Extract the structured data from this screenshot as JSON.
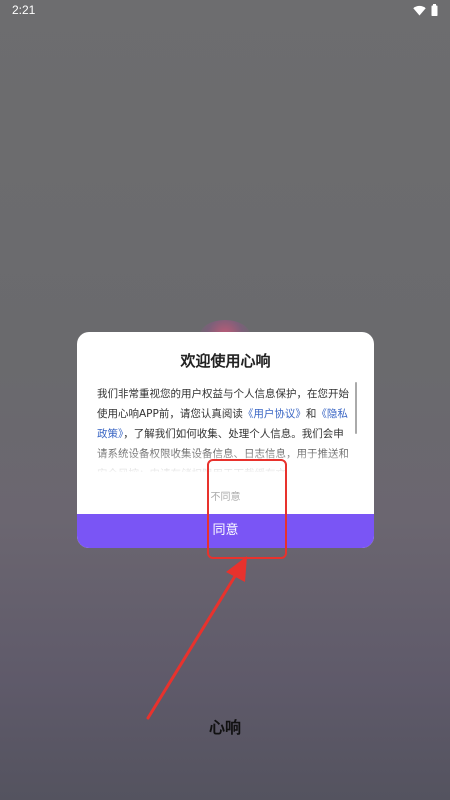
{
  "status_bar": {
    "time": "2:21",
    "wifi_icon": "wifi-icon",
    "battery_icon": "battery-icon"
  },
  "dialog": {
    "title": "欢迎使用心响",
    "body": {
      "p1": "我们非常重视您的用户权益与个人信息保护，在您开始使用心响APP前，请您认真阅读",
      "link_user_agreement": "《用户协议》",
      "and": "和",
      "link_privacy_policy": "《隐私政策》",
      "p2": "，了解我们如何收集、处理个人信息。我们会申请系统设备权限收集设备信息、日志信息，用于推送和安全风控；申请存储权限用于下载缓存文"
    },
    "disagree_label": "不同意",
    "agree_label": "同意"
  },
  "app_name": "心响",
  "colors": {
    "accent": "#7a55f5",
    "link": "#3a66c4",
    "annotation": "#e8322d"
  }
}
